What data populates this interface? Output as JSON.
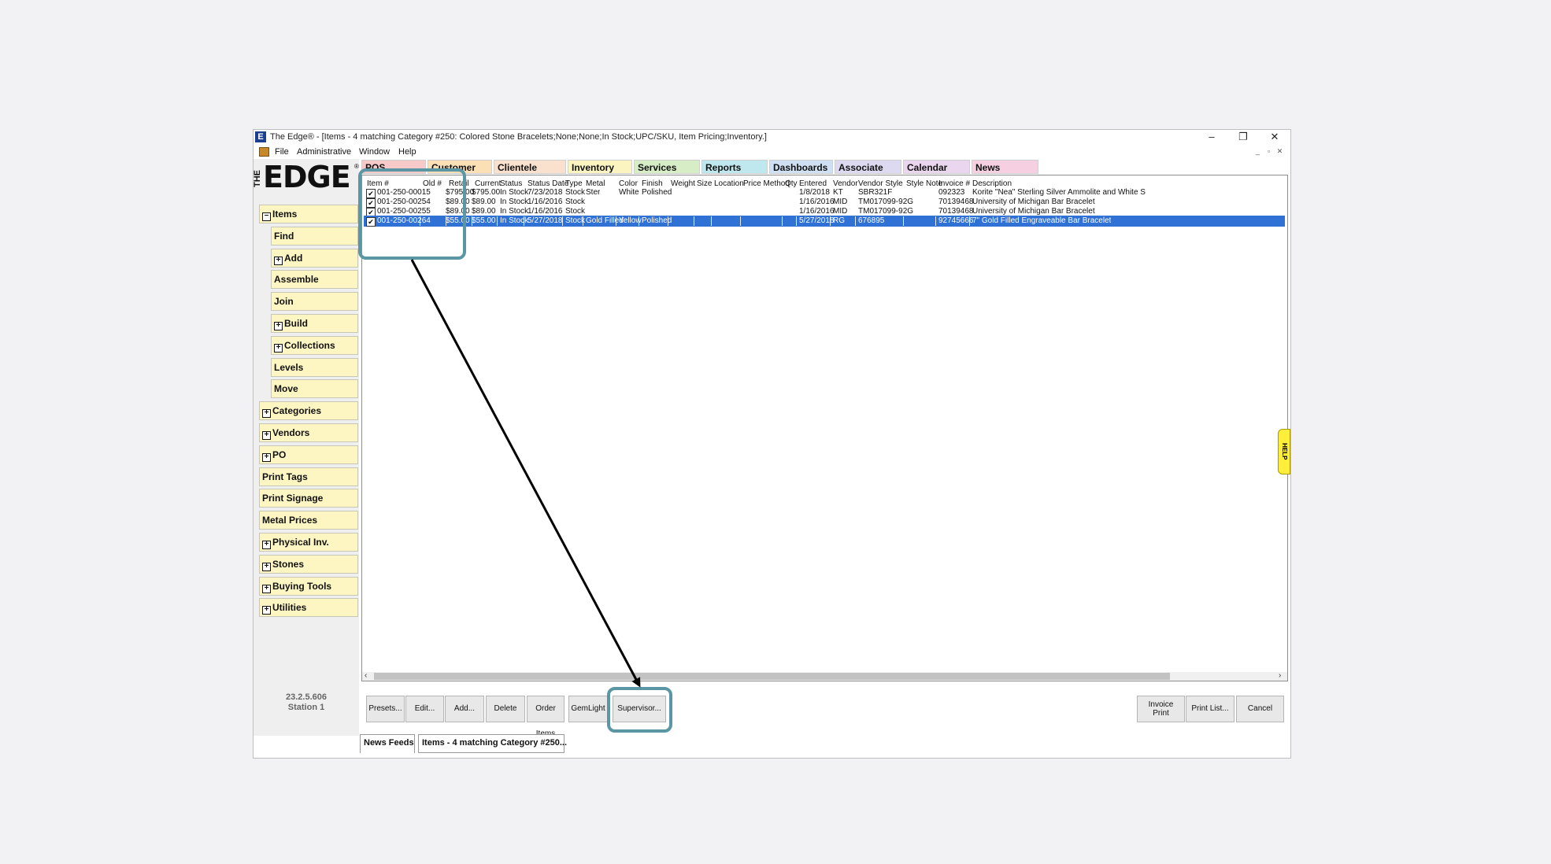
{
  "window": {
    "title": "The Edge® - [Items - 4 matching Category #250: Colored Stone Bracelets;None;None;In Stock;UPC/SKU, Item Pricing;Inventory.]",
    "app_icon": "E",
    "min": "–",
    "max": "❐",
    "close": "✕"
  },
  "menu": {
    "items": [
      "File",
      "Administrative",
      "Window",
      "Help"
    ],
    "mdi": [
      "_",
      "▫",
      "✕"
    ]
  },
  "logo": {
    "the": "THE",
    "edge": "EDGE",
    "reg": "®"
  },
  "tabs": [
    {
      "label": "POS",
      "color": "#f7c9c9"
    },
    {
      "label": "Customer",
      "color": "#fbe0b6"
    },
    {
      "label": "Clientele",
      "color": "#fae1cd"
    },
    {
      "label": "Inventory",
      "color": "#fbf3c0"
    },
    {
      "label": "Services",
      "color": "#d7edc5"
    },
    {
      "label": "Reports",
      "color": "#bfe8ee"
    },
    {
      "label": "Dashboards",
      "color": "#cfe0f3"
    },
    {
      "label": "Associate",
      "color": "#dcd9f0"
    },
    {
      "label": "Calendar",
      "color": "#ead7ef"
    },
    {
      "label": "News",
      "color": "#f6cfe0"
    }
  ],
  "nav": [
    {
      "label": "Items",
      "expander": "−"
    },
    {
      "label": "Find",
      "expander": ""
    },
    {
      "label": "Add",
      "expander": "+"
    },
    {
      "label": "Assemble",
      "expander": ""
    },
    {
      "label": "Join",
      "expander": ""
    },
    {
      "label": "Build",
      "expander": "+"
    },
    {
      "label": "Collections",
      "expander": "+"
    },
    {
      "label": "Levels",
      "expander": ""
    },
    {
      "label": "Move",
      "expander": ""
    },
    {
      "label": "Categories",
      "expander": "+"
    },
    {
      "label": "Vendors",
      "expander": "+"
    },
    {
      "label": "PO",
      "expander": "+"
    },
    {
      "label": "Print Tags",
      "expander": ""
    },
    {
      "label": "Print Signage",
      "expander": ""
    },
    {
      "label": "Metal Prices",
      "expander": ""
    },
    {
      "label": "Physical Inv.",
      "expander": "+"
    },
    {
      "label": "Stones",
      "expander": "+"
    },
    {
      "label": "Buying Tools",
      "expander": "+"
    },
    {
      "label": "Utilities",
      "expander": "+"
    }
  ],
  "version": {
    "number": "23.2.5.606",
    "station": "Station 1"
  },
  "grid": {
    "columns": [
      "Item #",
      "Old #",
      "Retail",
      "Current",
      "Status",
      "Status Date",
      "Type",
      "Metal",
      "Color",
      "Finish",
      "Weight",
      "Size",
      "Location",
      "Price Method",
      "Qty",
      "Entered",
      "Vendor",
      "Vendor Style",
      "Style Note",
      "Invoice #",
      "Description"
    ],
    "rows": [
      {
        "checked": "✔",
        "cells": [
          "001-250-00015",
          "",
          "$795.00",
          "$795.00",
          "In Stock",
          "7/23/2018",
          "Stock",
          "Ster",
          "White",
          "Polished",
          "",
          "",
          "",
          "",
          "",
          "1/8/2018",
          "KT",
          "SBR321F",
          "",
          "092323",
          "Korite \"Nea\" Sterling Silver Ammolite and White S"
        ]
      },
      {
        "checked": "✔",
        "cells": [
          "001-250-00254",
          "",
          "$89.00",
          "$89.00",
          "In Stock",
          "1/16/2016",
          "Stock",
          "",
          "",
          "",
          "",
          "",
          "",
          "",
          "",
          "1/16/2016",
          "MID",
          "TM017099-92G",
          "",
          "70139468",
          "University of Michigan Bar Bracelet"
        ]
      },
      {
        "checked": "✔",
        "cells": [
          "001-250-00255",
          "",
          "$89.00",
          "$89.00",
          "In Stock",
          "1/16/2016",
          "Stock",
          "",
          "",
          "",
          "",
          "",
          "",
          "",
          "",
          "1/16/2016",
          "MID",
          "TM017099-92G",
          "",
          "70139468",
          "University of Michigan Bar Bracelet"
        ]
      },
      {
        "checked": "✔",
        "cells": [
          "001-250-00264",
          "",
          "$55.00",
          "$55.00",
          "In Stock",
          "5/27/2018",
          "Stock",
          "Gold Filled",
          "Yellow",
          "Polished",
          "",
          "",
          "",
          "",
          "",
          "5/27/2018",
          "RG",
          "676895",
          "",
          "92745666",
          "7\" Gold Filled Engraveable Bar Bracelet"
        ]
      }
    ],
    "selected_row": 3,
    "scroll_left": "‹",
    "scroll_right": "›"
  },
  "buttons": {
    "presets": "Presets...",
    "edit": "Edit...",
    "add": "Add...",
    "delete": "Delete",
    "order_items": "Order Items",
    "gemlight": "GemLight",
    "supervisor": "Supervisor...",
    "invoice_print_1": "Invoice",
    "invoice_print_2": "Print",
    "print_list": "Print List...",
    "cancel": "Cancel"
  },
  "bottom_tabs": [
    "News Feeds",
    "Items - 4 matching Category #250..."
  ],
  "help_tab": "HELP"
}
